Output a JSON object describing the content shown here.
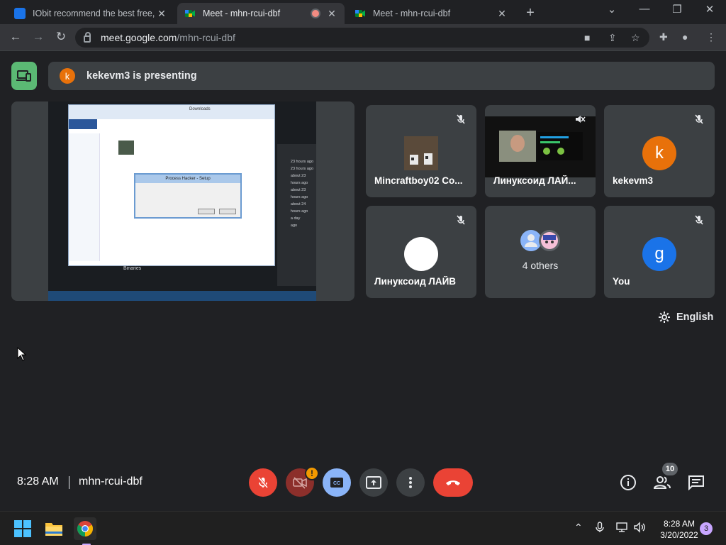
{
  "browser": {
    "tabs": [
      {
        "label": "IObit recommend the best free,",
        "active": false,
        "favicon": "iobit-icon",
        "favicon_color": "#1a73e8"
      },
      {
        "label": "Meet - mhn-rcui-dbf",
        "active": true,
        "favicon": "meet-icon",
        "recording": true
      },
      {
        "label": "Meet - mhn-rcui-dbf",
        "active": false,
        "favicon": "meet-icon"
      }
    ],
    "url_host": "meet.google.com",
    "url_path": "/mhn-rcui-dbf"
  },
  "banner": {
    "avatar_letter": "k",
    "text": "kekevm3 is presenting"
  },
  "participants": [
    {
      "name": "Mincraftboy02 Co...",
      "type": "photo",
      "muted": true
    },
    {
      "name": "Линуксоид ЛАЙ...",
      "type": "video",
      "muted": true
    },
    {
      "name": "kekevm3",
      "type": "letter",
      "letter": "k",
      "color": "#e8710a",
      "muted": true
    },
    {
      "name": "Линуксоид ЛАЙВ",
      "type": "blank",
      "muted": true
    },
    {
      "name": "",
      "type": "others",
      "label": "4 others"
    },
    {
      "name": "You",
      "type": "letter",
      "letter": "g",
      "color": "#1a73e8",
      "muted": true
    }
  ],
  "captions_language": "English",
  "bottom": {
    "time": "8:28 AM",
    "meeting_code": "mhn-rcui-dbf",
    "alert_badge": "!",
    "people_count": "10"
  },
  "shared_screen": {
    "app_title": "Downloads",
    "dialog_title": "Process Hacker - Setup",
    "binaries_label": "Binaries",
    "times": [
      "23 hours ago",
      "23 hours ago",
      "about 23",
      "hours ago",
      "about 23",
      "hours ago",
      "about 24",
      "hours ago",
      "a day",
      "ago"
    ]
  },
  "taskbar": {
    "time": "8:28 AM",
    "date": "3/20/2022",
    "notifications": "3"
  },
  "colors": {
    "end_call": "#ea4335",
    "mic_off": "#ea4335",
    "cam_off": "#8c2f2b",
    "captions_on": "#8ab4f8",
    "presenting": "#5bb974"
  }
}
